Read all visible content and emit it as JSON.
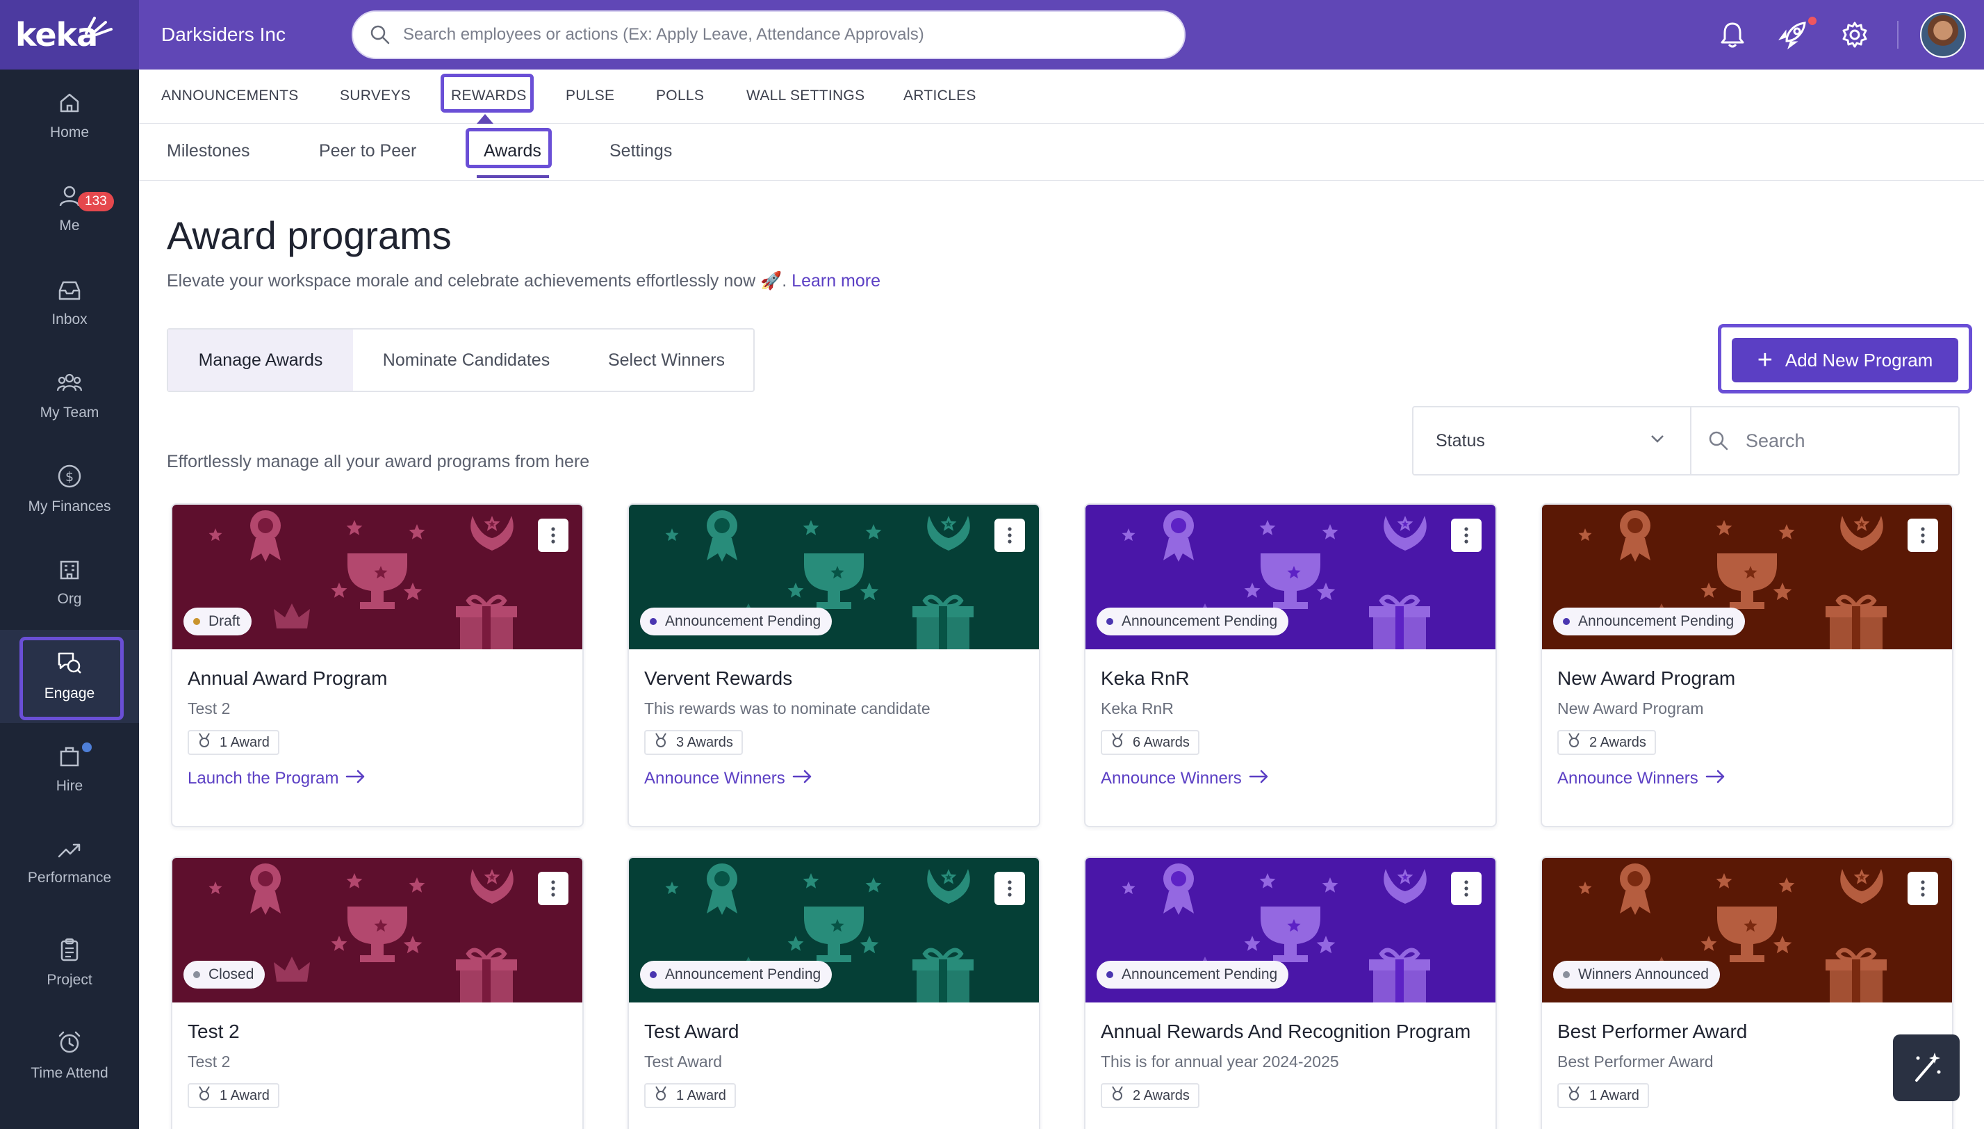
{
  "brand": {
    "logo": "keka",
    "company": "Darksiders Inc"
  },
  "search": {
    "placeholder": "Search employees or actions (Ex: Apply Leave, Attendance Approvals)"
  },
  "sidebar": {
    "items": [
      {
        "label": "Home",
        "icon": "home-icon"
      },
      {
        "label": "Me",
        "icon": "user-icon"
      },
      {
        "label": "Inbox",
        "icon": "inbox-icon",
        "badge": "133"
      },
      {
        "label": "My Team",
        "icon": "team-icon"
      },
      {
        "label": "My Finances",
        "icon": "dollar-icon"
      },
      {
        "label": "Org",
        "icon": "building-icon"
      },
      {
        "label": "Engage",
        "icon": "engage-icon",
        "active": true
      },
      {
        "label": "Hire",
        "icon": "briefcase-icon"
      },
      {
        "label": "Performance",
        "icon": "trend-icon"
      },
      {
        "label": "Project",
        "icon": "clipboard-icon"
      },
      {
        "label": "Time Attend",
        "icon": "alarm-icon"
      }
    ]
  },
  "tabs": [
    "ANNOUNCEMENTS",
    "SURVEYS",
    "REWARDS",
    "PULSE",
    "POLLS",
    "WALL SETTINGS",
    "ARTICLES"
  ],
  "subtabs": [
    "Milestones",
    "Peer to Peer",
    "Awards",
    "Settings"
  ],
  "page": {
    "title": "Award programs",
    "subtitle": "Elevate your workspace morale and celebrate achievements effortlessly now 🚀. ",
    "learn_more": "Learn more",
    "segments": [
      "Manage Awards",
      "Nominate Candidates",
      "Select Winners"
    ],
    "add_button": "Add New Program",
    "status_filter": "Status",
    "search_placeholder": "Search",
    "manage_note": "Effortlessly manage all your award programs from here"
  },
  "colors": {
    "accent": "#5b3fc4",
    "topbar": "#6047b6",
    "sidebar": "#1d2536"
  },
  "cards": [
    {
      "theme": "maroon",
      "status": "Draft",
      "title": "Annual Award Program",
      "desc": "Test 2",
      "awards": "1 Award",
      "link": "Launch the Program"
    },
    {
      "theme": "teal",
      "status": "Announcement Pending",
      "title": "Vervent Rewards",
      "desc": "This rewards was to nominate candidate",
      "awards": "3 Awards",
      "link": "Announce Winners"
    },
    {
      "theme": "purple",
      "status": "Announcement Pending",
      "title": "Keka RnR",
      "desc": "Keka RnR",
      "awards": "6 Awards",
      "link": "Announce Winners"
    },
    {
      "theme": "rust",
      "status": "Announcement Pending",
      "title": "New Award Program",
      "desc": "New Award Program",
      "awards": "2 Awards",
      "link": "Announce Winners"
    },
    {
      "theme": "maroon",
      "status": "Closed",
      "title": "Test 2",
      "desc": "Test 2",
      "awards": "1 Award",
      "link": ""
    },
    {
      "theme": "teal",
      "status": "Announcement Pending",
      "title": "Test Award",
      "desc": "Test Award",
      "awards": "1 Award",
      "link": ""
    },
    {
      "theme": "purple",
      "status": "Announcement Pending",
      "title": "Annual Rewards And Recognition Program",
      "desc": "This is for annual year 2024-2025",
      "awards": "2 Awards",
      "link": ""
    },
    {
      "theme": "rust",
      "status": "Winners Announced",
      "title": "Best Performer Award",
      "desc": "Best Performer Award",
      "awards": "1 Award",
      "link": ""
    }
  ]
}
